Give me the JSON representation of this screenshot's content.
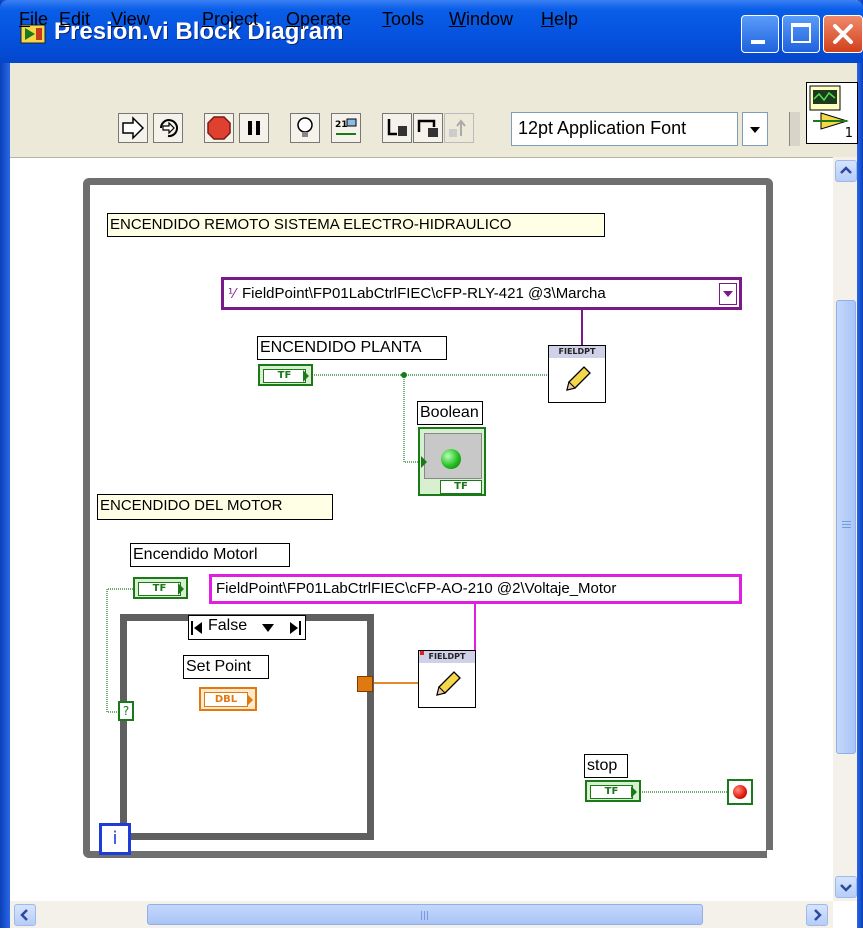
{
  "window": {
    "title": "Presion.vi Block Diagram",
    "accent_color": "#0553e0"
  },
  "menu": {
    "items": [
      {
        "label": "File",
        "mnemonic": "F",
        "rest": "ile"
      },
      {
        "label": "Edit",
        "mnemonic": "E",
        "rest": "dit"
      },
      {
        "label": "View",
        "mnemonic": "V",
        "rest": "iew"
      },
      {
        "label": "Project",
        "mnemonic": "P",
        "rest": "roject"
      },
      {
        "label": "Operate",
        "mnemonic": "O",
        "rest": "perate"
      },
      {
        "label": "Tools",
        "mnemonic": "T",
        "rest": "ools"
      },
      {
        "label": "Window",
        "mnemonic": "W",
        "rest": "indow"
      },
      {
        "label": "Help",
        "mnemonic": "H",
        "rest": "elp"
      }
    ]
  },
  "toolbar": {
    "buttons": [
      "run-icon",
      "run-continuously-icon",
      "abort-icon",
      "pause-icon",
      "highlight-execution-icon",
      "retain-wire-values-icon",
      "step-into-icon",
      "step-over-icon",
      "step-out-icon"
    ],
    "font_select": "12pt Application Font",
    "vi_icon_number": "1"
  },
  "diagram": {
    "comment_remote": "ENCENDIDO REMOTO SISTEMA ELECTRO-HIDRAULICO",
    "comment_motor": "ENCENDIDO DEL MOTOR",
    "io_relay": "FieldPoint\\FP01LabCtrlFIEC\\cFP-RLY-421 @3\\Marcha",
    "io_analog": "FieldPoint\\FP01LabCtrlFIEC\\cFP-AO-210 @2\\Voltaje_Motor",
    "label_encendido_planta": "ENCENDIDO PLANTA",
    "label_boolean": "Boolean",
    "label_encendido_motor": "Encendido Motorl",
    "label_set_point": "Set Point",
    "label_stop": "stop",
    "terminal_tf": "TF",
    "terminal_dbl": "DBL",
    "fieldpoint_node": "FIELDPT",
    "case_selector": "False",
    "case_selector_terminal": "?",
    "iteration_terminal": "i",
    "colors": {
      "boolean_wire": "#1a7a1a",
      "numeric_wire": "#e07a10",
      "io_purple": "#7a1a8a",
      "io_magenta": "#e020e0"
    }
  }
}
